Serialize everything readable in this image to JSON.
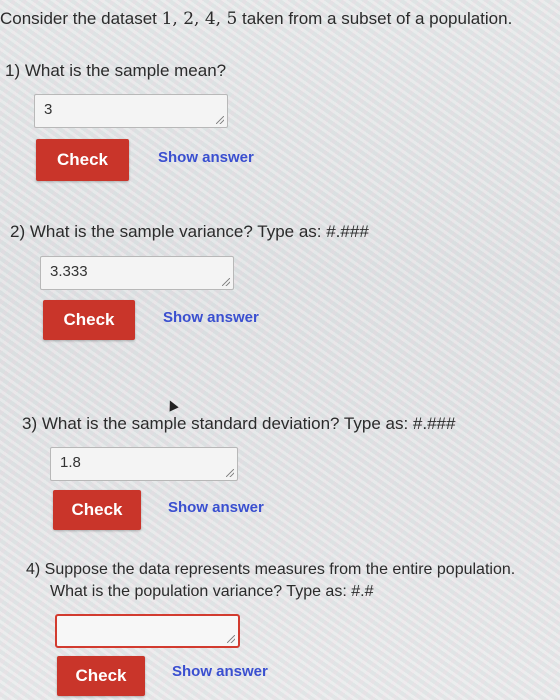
{
  "intro": {
    "prefix": "Consider the dataset ",
    "dataset": "1, 2, 4, 5",
    "suffix": " taken from a subset of a population."
  },
  "questions": [
    {
      "text": "1) What is the sample mean?",
      "answer": "3",
      "check_label": "Check",
      "show_label": "Show answer"
    },
    {
      "text": "2) What is the sample variance? Type as: #.###",
      "answer": "3.333",
      "check_label": "Check",
      "show_label": "Show answer"
    },
    {
      "text": "3) What is the sample standard deviation? Type as: #.###",
      "answer": "1.8",
      "check_label": "Check",
      "show_label": "Show answer"
    },
    {
      "text_line1": "4) Suppose the data represents measures from the entire population.",
      "text_line2": "What is the population variance? Type as: #.#",
      "answer": "",
      "check_label": "Check",
      "show_label": "Show answer"
    }
  ],
  "colors": {
    "check_button": "#c9352a",
    "show_answer_link": "#3a4fd0",
    "empty_field_border": "#d23b2f"
  }
}
